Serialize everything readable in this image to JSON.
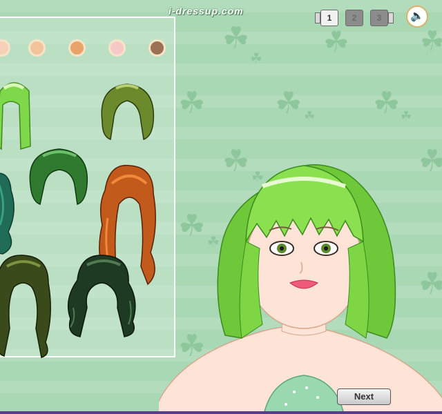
{
  "header": {
    "brand_text": "i-dressup.com",
    "pages": [
      {
        "label": "1",
        "state": "active"
      },
      {
        "label": "2",
        "state": "inactive"
      },
      {
        "label": "3",
        "state": "inactive"
      }
    ],
    "sound_icon": "speaker-icon"
  },
  "hair_colors": [
    "#f6d0b8",
    "#f2c39d",
    "#e8a368",
    "#f7c8c8",
    "#9a7155"
  ],
  "hairstyles": [
    {
      "name": "lime-straight-bob",
      "color": "#7fd84a"
    },
    {
      "name": "olive-updo",
      "color": "#6a8a2c"
    },
    {
      "name": "teal-long-waves",
      "color": "#1f6b55"
    },
    {
      "name": "green-short-crop",
      "color": "#2f7a2f"
    },
    {
      "name": "auburn-long-waves",
      "color": "#c15a1a"
    },
    {
      "name": "olive-dark-long",
      "color": "#3a4a1a"
    },
    {
      "name": "dark-green-curls",
      "color": "#1f3a22"
    }
  ],
  "footer": {
    "next_label": "Next"
  }
}
